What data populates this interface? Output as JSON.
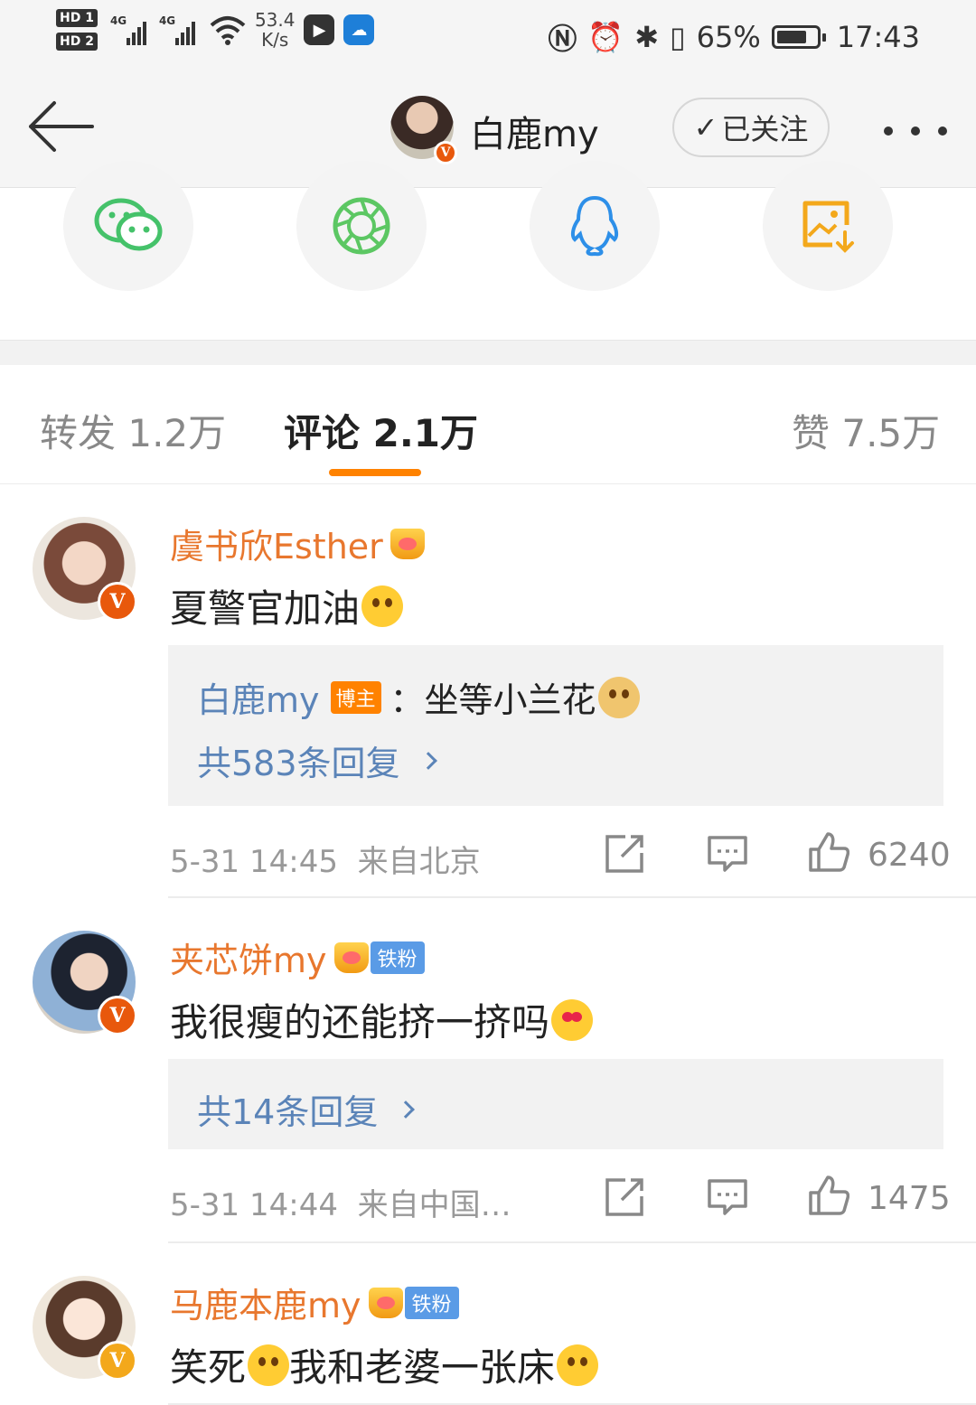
{
  "status_bar": {
    "hd1": "HD 1",
    "hd2": "HD 2",
    "net1": "4G",
    "net2": "4G",
    "speed_value": "53.4",
    "speed_unit": "K/s",
    "battery": "65%",
    "time": "17:43"
  },
  "header": {
    "name": "白鹿my",
    "follow_label": "已关注"
  },
  "share": {
    "icons": [
      "wechat-icon",
      "moments-icon",
      "qq-icon",
      "save-image-icon"
    ]
  },
  "tabs": [
    {
      "label": "转发 1.2万"
    },
    {
      "label": "评论 2.1万"
    },
    {
      "label": "赞 7.5万"
    }
  ],
  "comments": [
    {
      "name": "虞书欣Esther",
      "text": "夏警官加油",
      "reply": {
        "user": "白鹿my",
        "tag": "博主",
        "text": "：坐等小兰花"
      },
      "reply_count": "共583条回复",
      "time": "5-31 14:45",
      "location": "来自北京",
      "likes": "6240"
    },
    {
      "name": "夹芯饼my",
      "fan_tag": "铁粉",
      "text": "我很瘦的还能挤一挤吗",
      "reply_count": "共14条回复",
      "time": "5-31 14:44",
      "location": "来自中国…",
      "likes": "1475"
    },
    {
      "name": "马鹿本鹿my",
      "fan_tag": "铁粉",
      "text_a": "笑死",
      "text_b": "我和老婆一张床"
    }
  ],
  "colors": {
    "accent": "#ff8200",
    "name": "#e8772e",
    "link": "#5b84b8"
  }
}
